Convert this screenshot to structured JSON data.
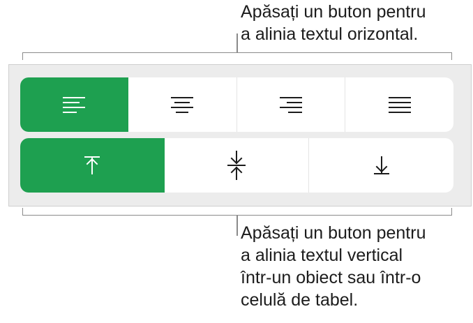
{
  "callouts": {
    "horizontal": "Apăsați un buton pentru\na alinia textul orizontal.",
    "vertical": "Apăsați un buton pentru\na alinia textul vertical\nîntr-un obiect sau într-o\ncelulă de tabel."
  },
  "horizontal_alignment": {
    "selected": "left",
    "buttons": [
      {
        "name": "align-left",
        "icon": "align-left-icon"
      },
      {
        "name": "align-center",
        "icon": "align-center-icon"
      },
      {
        "name": "align-right",
        "icon": "align-right-icon"
      },
      {
        "name": "justify",
        "icon": "justify-icon"
      }
    ]
  },
  "vertical_alignment": {
    "selected": "top",
    "buttons": [
      {
        "name": "align-top",
        "icon": "align-top-icon"
      },
      {
        "name": "align-middle",
        "icon": "align-middle-icon"
      },
      {
        "name": "align-bottom",
        "icon": "align-bottom-icon"
      }
    ]
  },
  "colors": {
    "accent": "#1ea050",
    "panel": "#ececec",
    "bracket": "#8a8a8a"
  }
}
